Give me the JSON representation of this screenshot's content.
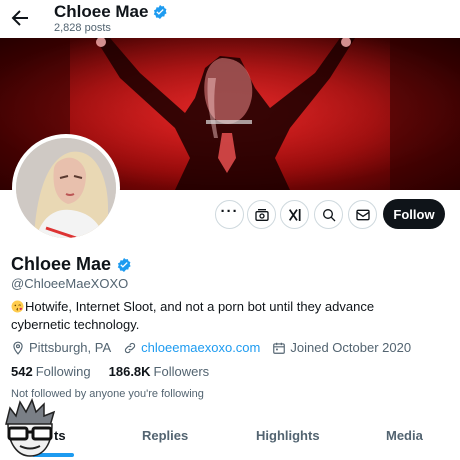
{
  "header": {
    "display_name": "Chloee Mae",
    "post_count": "2,828 posts"
  },
  "profile": {
    "display_name": "Chloee Mae",
    "handle": "@ChloeeMaeXOXO",
    "bio": "Hotwife, Internet Sloot, and not a porn bot until they advance cybernetic technology.",
    "location": "Pittsburgh, PA",
    "website": "chloeemaexoxo.com",
    "joined": "Joined October 2020",
    "following_count": "542",
    "following_label": "Following",
    "followers_count": "186.8K",
    "followers_label": "Followers",
    "followed_by_text": "Not followed by anyone you're following"
  },
  "actions": {
    "more_label": "···",
    "follow_label": "Follow"
  },
  "tabs": [
    {
      "label": "ts"
    },
    {
      "label": "Replies"
    },
    {
      "label": "Highlights"
    },
    {
      "label": "Media"
    }
  ],
  "colors": {
    "accent": "#1d9bf0",
    "text": "#0f1419",
    "secondary": "#536471",
    "border": "#cfd9de",
    "banner": "#c21010"
  },
  "icons": {
    "back": "arrow-left-icon",
    "verified": "verified-badge-icon",
    "subscribe": "subscribe-icon",
    "grok": "grok-icon",
    "search": "search-icon",
    "message": "mail-icon",
    "location": "location-pin-icon",
    "link": "link-icon",
    "calendar": "calendar-icon"
  }
}
